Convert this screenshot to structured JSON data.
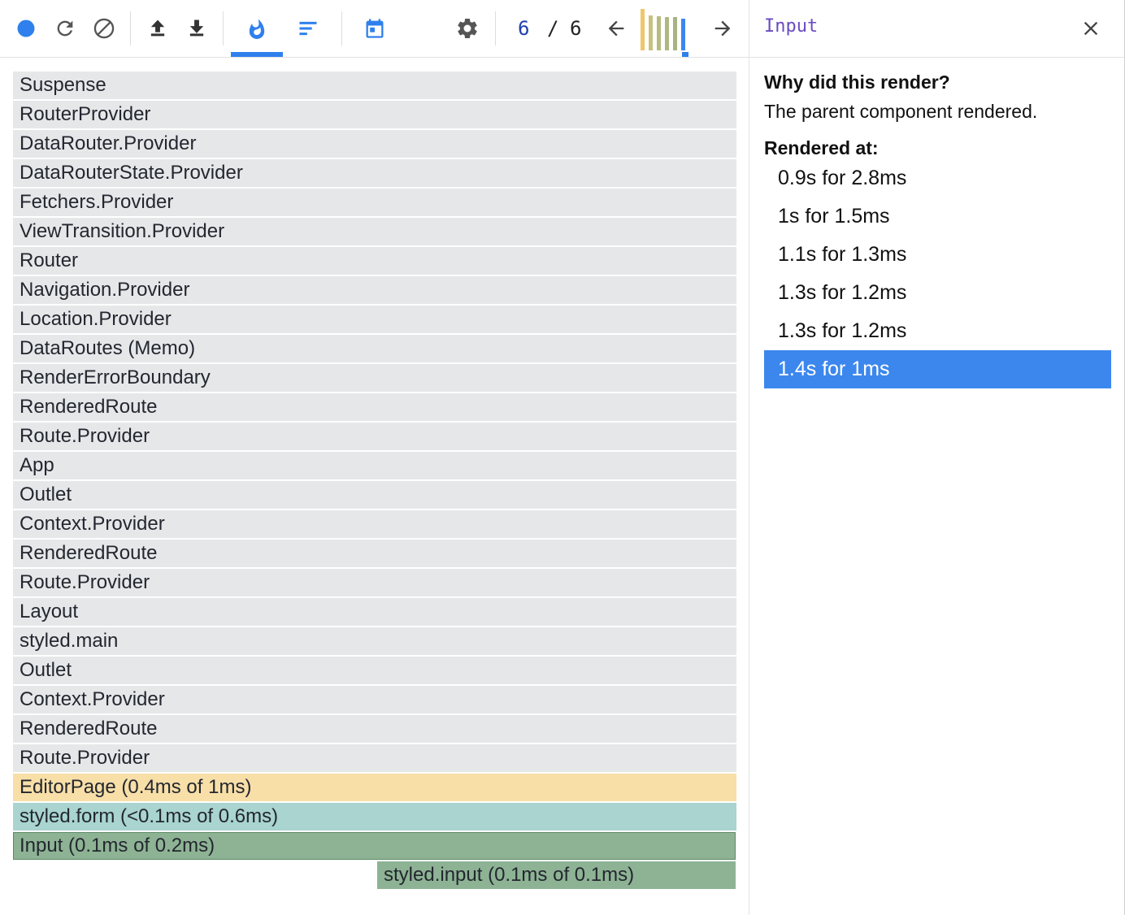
{
  "app": "React DevTools Profiler",
  "toolbar": {
    "icons": [
      "record-icon",
      "reload-and-profile-icon",
      "clear-icon",
      "load-profile-icon",
      "save-profile-icon",
      "flamegraph-tab-icon",
      "ranked-tab-icon",
      "timeline-tab-icon",
      "settings-icon",
      "previous-commit-icon",
      "next-commit-icon"
    ],
    "active_tab": "flamegraph",
    "commit_current": "6",
    "commit_separator": "/",
    "commit_total": "6",
    "commit_bars": [
      {
        "level": 0.95,
        "color": "#f0c66a"
      },
      {
        "level": 0.8,
        "color": "#c7c37e"
      },
      {
        "level": 0.78,
        "color": "#b7bb82"
      },
      {
        "level": 0.76,
        "color": "#b1b783"
      },
      {
        "level": 0.75,
        "color": "#a9b383"
      },
      {
        "level": 0.72,
        "color": "#3c87ee",
        "selected": true
      }
    ]
  },
  "flamegraph": {
    "rows": [
      {
        "label": "Suspense",
        "color": "#e6e7e9",
        "indent": 0
      },
      {
        "label": "RouterProvider",
        "color": "#e6e7e9",
        "indent": 0
      },
      {
        "label": "DataRouter.Provider",
        "color": "#e6e7e9",
        "indent": 0
      },
      {
        "label": "DataRouterState.Provider",
        "color": "#e6e7e9",
        "indent": 0
      },
      {
        "label": "Fetchers.Provider",
        "color": "#e6e7e9",
        "indent": 0
      },
      {
        "label": "ViewTransition.Provider",
        "color": "#e6e7e9",
        "indent": 0
      },
      {
        "label": "Router",
        "color": "#e6e7e9",
        "indent": 0
      },
      {
        "label": "Navigation.Provider",
        "color": "#e6e7e9",
        "indent": 0
      },
      {
        "label": "Location.Provider",
        "color": "#e6e7e9",
        "indent": 0
      },
      {
        "label": "DataRoutes (Memo)",
        "color": "#e6e7e9",
        "indent": 0
      },
      {
        "label": "RenderErrorBoundary",
        "color": "#e6e7e9",
        "indent": 0
      },
      {
        "label": "RenderedRoute",
        "color": "#e6e7e9",
        "indent": 0
      },
      {
        "label": "Route.Provider",
        "color": "#e6e7e9",
        "indent": 0
      },
      {
        "label": "App",
        "color": "#e6e7e9",
        "indent": 0
      },
      {
        "label": "Outlet",
        "color": "#e6e7e9",
        "indent": 0
      },
      {
        "label": "Context.Provider",
        "color": "#e6e7e9",
        "indent": 0
      },
      {
        "label": "RenderedRoute",
        "color": "#e6e7e9",
        "indent": 0
      },
      {
        "label": "Route.Provider",
        "color": "#e6e7e9",
        "indent": 0
      },
      {
        "label": "Layout",
        "color": "#e6e7e9",
        "indent": 0
      },
      {
        "label": "styled.main",
        "color": "#e6e7e9",
        "indent": 0
      },
      {
        "label": "Outlet",
        "color": "#e6e7e9",
        "indent": 0
      },
      {
        "label": "Context.Provider",
        "color": "#e6e7e9",
        "indent": 0
      },
      {
        "label": "RenderedRoute",
        "color": "#e6e7e9",
        "indent": 0
      },
      {
        "label": "Route.Provider",
        "color": "#e6e7e9",
        "indent": 0
      },
      {
        "label": "EditorPage (0.4ms of 1ms)",
        "color": "#f8dfa8",
        "indent": 0
      },
      {
        "label": "styled.form (<0.1ms of 0.6ms)",
        "color": "#a9d4d0",
        "indent": 0
      },
      {
        "label": "Input (0.1ms of 0.2ms)",
        "color": "#8db394",
        "indent": 0,
        "selected": true
      },
      {
        "label": "styled.input (0.1ms of 0.1ms)",
        "color": "#8db394",
        "indent": 0.503
      }
    ]
  },
  "sidebar": {
    "title": "Input",
    "why_heading": "Why did this render?",
    "reason": "The parent component rendered.",
    "rendered_at_heading": "Rendered at:",
    "renders": [
      {
        "label": "0.9s for 2.8ms",
        "selected": false
      },
      {
        "label": "1s for 1.5ms",
        "selected": false
      },
      {
        "label": "1.1s for 1.3ms",
        "selected": false
      },
      {
        "label": "1.3s for 1.2ms",
        "selected": false
      },
      {
        "label": "1.3s for 1.2ms",
        "selected": false
      },
      {
        "label": "1.4s for 1ms",
        "selected": true
      }
    ]
  }
}
